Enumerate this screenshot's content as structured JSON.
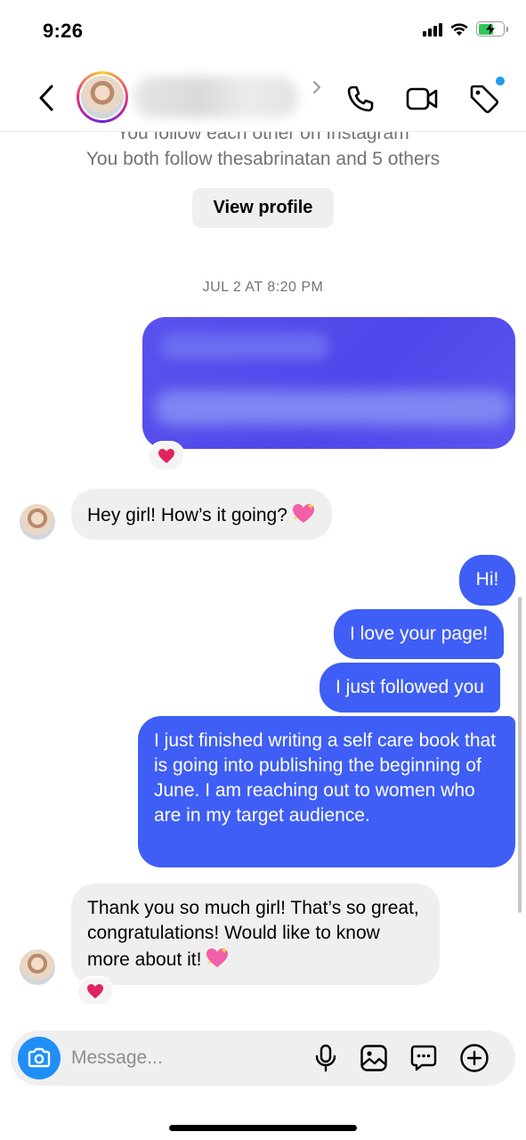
{
  "status_bar": {
    "time": "9:26",
    "battery_charging": true,
    "battery_level_percent": 60,
    "icons": [
      "signal-icon",
      "wifi-icon",
      "battery-icon"
    ]
  },
  "header": {
    "back_icon": "chevron-left-icon",
    "contact_name": "",
    "actions": [
      "phone-icon",
      "video-icon",
      "tag-icon"
    ],
    "notification_dot_color": "#1f9bf0"
  },
  "profile": {
    "partial_line": "You follow each other on Instagram",
    "mutual_text": "You both follow thesabrinatan and 5 others",
    "view_profile_label": "View profile"
  },
  "conversation": {
    "timestamp": "JUL 2 AT 8:20 PM",
    "messages": [
      {
        "from": "me",
        "text": "",
        "blurred": true,
        "reaction": "heart"
      },
      {
        "from": "them",
        "text": "Hey girl! How’s it going?",
        "emoji": "sparkling-heart"
      },
      {
        "from": "me",
        "text": "Hi!"
      },
      {
        "from": "me",
        "text": "I love your page!"
      },
      {
        "from": "me",
        "text": "I just followed you"
      },
      {
        "from": "me",
        "text": "I just finished writing a self care book that is going into publishing the beginning of June. I am reaching out to women who are in my target audience."
      },
      {
        "from": "them",
        "text": "Thank you so much girl! That’s so great, congratulations! Would like to know more about it!",
        "emoji": "sparkling-heart",
        "reaction": "heart"
      }
    ]
  },
  "composer": {
    "placeholder": "Message...",
    "value": "",
    "icons": [
      "camera-icon",
      "microphone-icon",
      "image-icon",
      "sticker-chat-icon",
      "plus-circle-icon"
    ]
  },
  "colors": {
    "outgoing_bubble": "#3f5ef5",
    "incoming_bubble": "#efefef",
    "camera_button": "#1f8ff5",
    "reaction_heart": "#e0245e"
  }
}
